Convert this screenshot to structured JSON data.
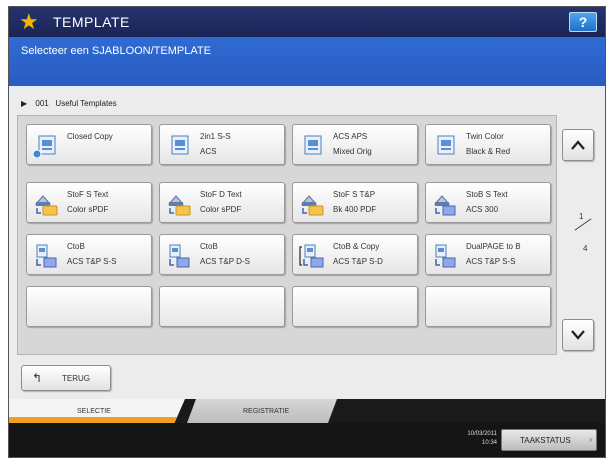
{
  "header": {
    "title": "TEMPLATE",
    "help_label": "?",
    "instruction": "Selecteer een SJABLOON/TEMPLATE"
  },
  "group": {
    "number": "001",
    "name": "Useful Templates"
  },
  "templates": [
    {
      "line1": "Closed Copy",
      "line2": "",
      "icon": "copy-doc-icon"
    },
    {
      "line1": "2in1 S-S",
      "line2": "ACS",
      "icon": "copy-doc-icon"
    },
    {
      "line1": "ACS APS",
      "line2": "Mixed Orig",
      "icon": "copy-doc-icon"
    },
    {
      "line1": "Twin Color",
      "line2": "Black & Red",
      "icon": "copy-doc-icon"
    },
    {
      "line1": "StoF S Text",
      "line2": "Color sPDF",
      "icon": "scan-to-folder-icon"
    },
    {
      "line1": "StoF D Text",
      "line2": "Color sPDF",
      "icon": "scan-to-folder-icon"
    },
    {
      "line1": "StoF S T&P",
      "line2": "Bk 400 PDF",
      "icon": "scan-to-folder-icon"
    },
    {
      "line1": "StoB S Text",
      "line2": "ACS 300",
      "icon": "scan-to-box-icon"
    },
    {
      "line1": "CtoB",
      "line2": "ACS T&P S-S",
      "icon": "copy-to-box-icon"
    },
    {
      "line1": "CtoB",
      "line2": "ACS T&P D-S",
      "icon": "copy-to-box-icon"
    },
    {
      "line1": "CtoB & Copy",
      "line2": "ACS T&P S-D",
      "icon": "copy-to-box-icon"
    },
    {
      "line1": "DualPAGE to B",
      "line2": "ACS T&P S-S",
      "icon": "copy-to-box-icon"
    },
    {
      "line1": "",
      "line2": "",
      "icon": ""
    },
    {
      "line1": "",
      "line2": "",
      "icon": ""
    },
    {
      "line1": "",
      "line2": "",
      "icon": ""
    },
    {
      "line1": "",
      "line2": "",
      "icon": ""
    }
  ],
  "pager": {
    "current": "1",
    "total": "4"
  },
  "back_label": "TERUG",
  "tabs": {
    "active": "SELECTIE",
    "inactive": "REGISTRATIE"
  },
  "status": {
    "date": "10/03/2011",
    "time": "10:34",
    "job_status_label": "TAAKSTATUS"
  },
  "colors": {
    "title_bar": "#1a2456",
    "sub_bar": "#2f6bd3",
    "star": "#f5b400",
    "tab_accent": "#f0a020"
  }
}
